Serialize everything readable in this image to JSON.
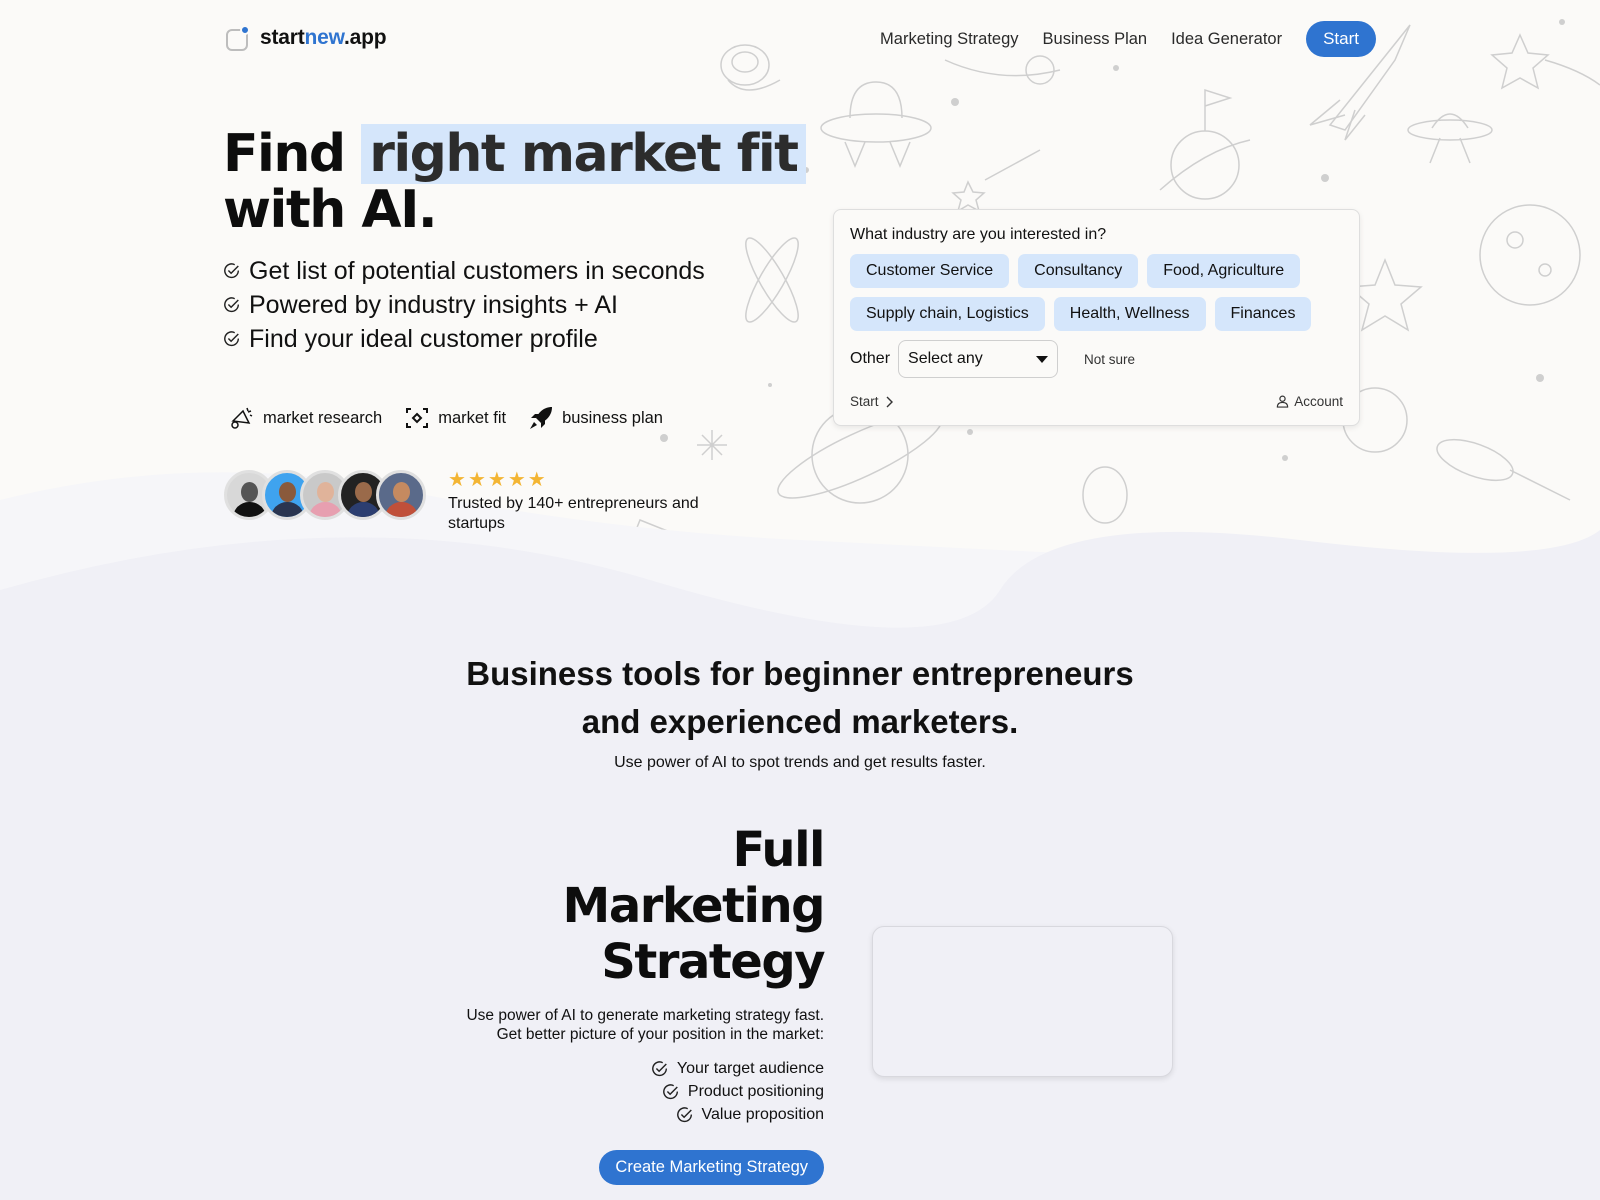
{
  "brand": {
    "prefix": "start",
    "accent": "new",
    "suffix": ".app",
    "accent_color": "#2f74d0"
  },
  "nav": {
    "links": [
      "Marketing Strategy",
      "Business Plan",
      "Idea Generator"
    ],
    "start_label": "Start"
  },
  "hero": {
    "title_prefix": "Find ",
    "title_highlight": "right market fit",
    "title_line2": "with AI.",
    "bullets": [
      "Get list of potential customers in seconds",
      "Powered by industry insights + AI",
      "Find your ideal customer profile"
    ],
    "features": [
      {
        "icon": "megaphone-icon",
        "label": "market research"
      },
      {
        "icon": "focus-target-icon",
        "label": "market fit"
      },
      {
        "icon": "rocket-icon",
        "label": "business plan"
      }
    ],
    "rating_stars": 5,
    "trust_caption": "Trusted by 140+ entrepreneurs and startups"
  },
  "card": {
    "question": "What industry are you interested in?",
    "chips": [
      "Customer Service",
      "Consultancy",
      "Food, Agriculture",
      "Supply chain, Logistics",
      "Health, Wellness",
      "Finances"
    ],
    "other_label": "Other",
    "select_value": "Select any",
    "not_sure": "Not sure",
    "start_label": "Start",
    "account_label": "Account"
  },
  "section2": {
    "title_line1": "Business tools for beginner entrepreneurs",
    "title_line2": "and experienced marketers.",
    "subtitle": "Use power of AI to spot trends and get results faster."
  },
  "marketing": {
    "title_lines": [
      "Full",
      "Marketing",
      "Strategy"
    ],
    "desc_line1": "Use power of AI to generate marketing strategy fast.",
    "desc_line2": "Get better picture of your position in the market:",
    "items": [
      "Your target audience",
      "Product positioning",
      "Value proposition"
    ],
    "cta_label": "Create Marketing Strategy"
  }
}
